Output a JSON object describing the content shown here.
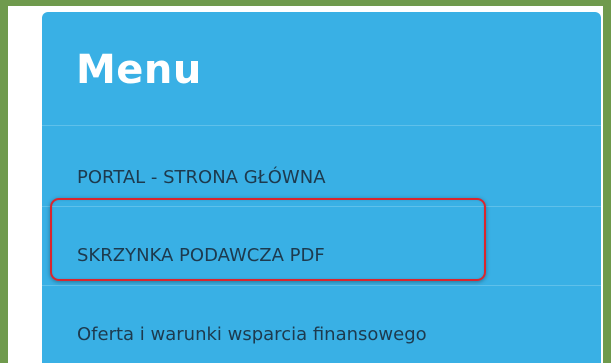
{
  "menu": {
    "title": "Menu",
    "items": [
      {
        "label": "PORTAL - STRONA GŁÓWNA"
      },
      {
        "label": "SKRZYNKA PODAWCZA PDF",
        "highlighted": true
      },
      {
        "label": "Oferta i warunki wsparcia finansowego"
      }
    ]
  },
  "colors": {
    "frame_border": "#6f9a4d",
    "menu_background": "#39b0e5",
    "title_text": "#ffffff",
    "item_text": "#1d3a4e",
    "highlight_border": "#d9262e"
  }
}
